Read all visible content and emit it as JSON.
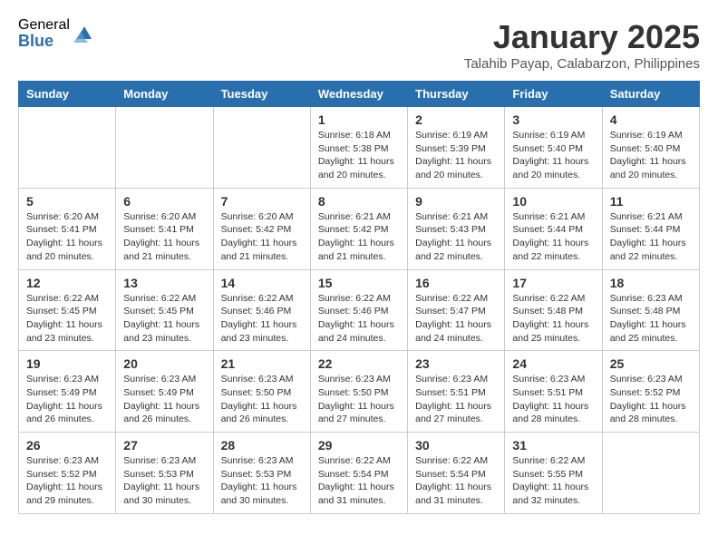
{
  "logo": {
    "general": "General",
    "blue": "Blue"
  },
  "title": "January 2025",
  "subtitle": "Talahib Payap, Calabarzon, Philippines",
  "days_of_week": [
    "Sunday",
    "Monday",
    "Tuesday",
    "Wednesday",
    "Thursday",
    "Friday",
    "Saturday"
  ],
  "weeks": [
    [
      {
        "day": "",
        "info": ""
      },
      {
        "day": "",
        "info": ""
      },
      {
        "day": "",
        "info": ""
      },
      {
        "day": "1",
        "info": "Sunrise: 6:18 AM\nSunset: 5:38 PM\nDaylight: 11 hours and 20 minutes."
      },
      {
        "day": "2",
        "info": "Sunrise: 6:19 AM\nSunset: 5:39 PM\nDaylight: 11 hours and 20 minutes."
      },
      {
        "day": "3",
        "info": "Sunrise: 6:19 AM\nSunset: 5:40 PM\nDaylight: 11 hours and 20 minutes."
      },
      {
        "day": "4",
        "info": "Sunrise: 6:19 AM\nSunset: 5:40 PM\nDaylight: 11 hours and 20 minutes."
      }
    ],
    [
      {
        "day": "5",
        "info": "Sunrise: 6:20 AM\nSunset: 5:41 PM\nDaylight: 11 hours and 20 minutes."
      },
      {
        "day": "6",
        "info": "Sunrise: 6:20 AM\nSunset: 5:41 PM\nDaylight: 11 hours and 21 minutes."
      },
      {
        "day": "7",
        "info": "Sunrise: 6:20 AM\nSunset: 5:42 PM\nDaylight: 11 hours and 21 minutes."
      },
      {
        "day": "8",
        "info": "Sunrise: 6:21 AM\nSunset: 5:42 PM\nDaylight: 11 hours and 21 minutes."
      },
      {
        "day": "9",
        "info": "Sunrise: 6:21 AM\nSunset: 5:43 PM\nDaylight: 11 hours and 22 minutes."
      },
      {
        "day": "10",
        "info": "Sunrise: 6:21 AM\nSunset: 5:44 PM\nDaylight: 11 hours and 22 minutes."
      },
      {
        "day": "11",
        "info": "Sunrise: 6:21 AM\nSunset: 5:44 PM\nDaylight: 11 hours and 22 minutes."
      }
    ],
    [
      {
        "day": "12",
        "info": "Sunrise: 6:22 AM\nSunset: 5:45 PM\nDaylight: 11 hours and 23 minutes."
      },
      {
        "day": "13",
        "info": "Sunrise: 6:22 AM\nSunset: 5:45 PM\nDaylight: 11 hours and 23 minutes."
      },
      {
        "day": "14",
        "info": "Sunrise: 6:22 AM\nSunset: 5:46 PM\nDaylight: 11 hours and 23 minutes."
      },
      {
        "day": "15",
        "info": "Sunrise: 6:22 AM\nSunset: 5:46 PM\nDaylight: 11 hours and 24 minutes."
      },
      {
        "day": "16",
        "info": "Sunrise: 6:22 AM\nSunset: 5:47 PM\nDaylight: 11 hours and 24 minutes."
      },
      {
        "day": "17",
        "info": "Sunrise: 6:22 AM\nSunset: 5:48 PM\nDaylight: 11 hours and 25 minutes."
      },
      {
        "day": "18",
        "info": "Sunrise: 6:23 AM\nSunset: 5:48 PM\nDaylight: 11 hours and 25 minutes."
      }
    ],
    [
      {
        "day": "19",
        "info": "Sunrise: 6:23 AM\nSunset: 5:49 PM\nDaylight: 11 hours and 26 minutes."
      },
      {
        "day": "20",
        "info": "Sunrise: 6:23 AM\nSunset: 5:49 PM\nDaylight: 11 hours and 26 minutes."
      },
      {
        "day": "21",
        "info": "Sunrise: 6:23 AM\nSunset: 5:50 PM\nDaylight: 11 hours and 26 minutes."
      },
      {
        "day": "22",
        "info": "Sunrise: 6:23 AM\nSunset: 5:50 PM\nDaylight: 11 hours and 27 minutes."
      },
      {
        "day": "23",
        "info": "Sunrise: 6:23 AM\nSunset: 5:51 PM\nDaylight: 11 hours and 27 minutes."
      },
      {
        "day": "24",
        "info": "Sunrise: 6:23 AM\nSunset: 5:51 PM\nDaylight: 11 hours and 28 minutes."
      },
      {
        "day": "25",
        "info": "Sunrise: 6:23 AM\nSunset: 5:52 PM\nDaylight: 11 hours and 28 minutes."
      }
    ],
    [
      {
        "day": "26",
        "info": "Sunrise: 6:23 AM\nSunset: 5:52 PM\nDaylight: 11 hours and 29 minutes."
      },
      {
        "day": "27",
        "info": "Sunrise: 6:23 AM\nSunset: 5:53 PM\nDaylight: 11 hours and 30 minutes."
      },
      {
        "day": "28",
        "info": "Sunrise: 6:23 AM\nSunset: 5:53 PM\nDaylight: 11 hours and 30 minutes."
      },
      {
        "day": "29",
        "info": "Sunrise: 6:22 AM\nSunset: 5:54 PM\nDaylight: 11 hours and 31 minutes."
      },
      {
        "day": "30",
        "info": "Sunrise: 6:22 AM\nSunset: 5:54 PM\nDaylight: 11 hours and 31 minutes."
      },
      {
        "day": "31",
        "info": "Sunrise: 6:22 AM\nSunset: 5:55 PM\nDaylight: 11 hours and 32 minutes."
      },
      {
        "day": "",
        "info": ""
      }
    ]
  ]
}
